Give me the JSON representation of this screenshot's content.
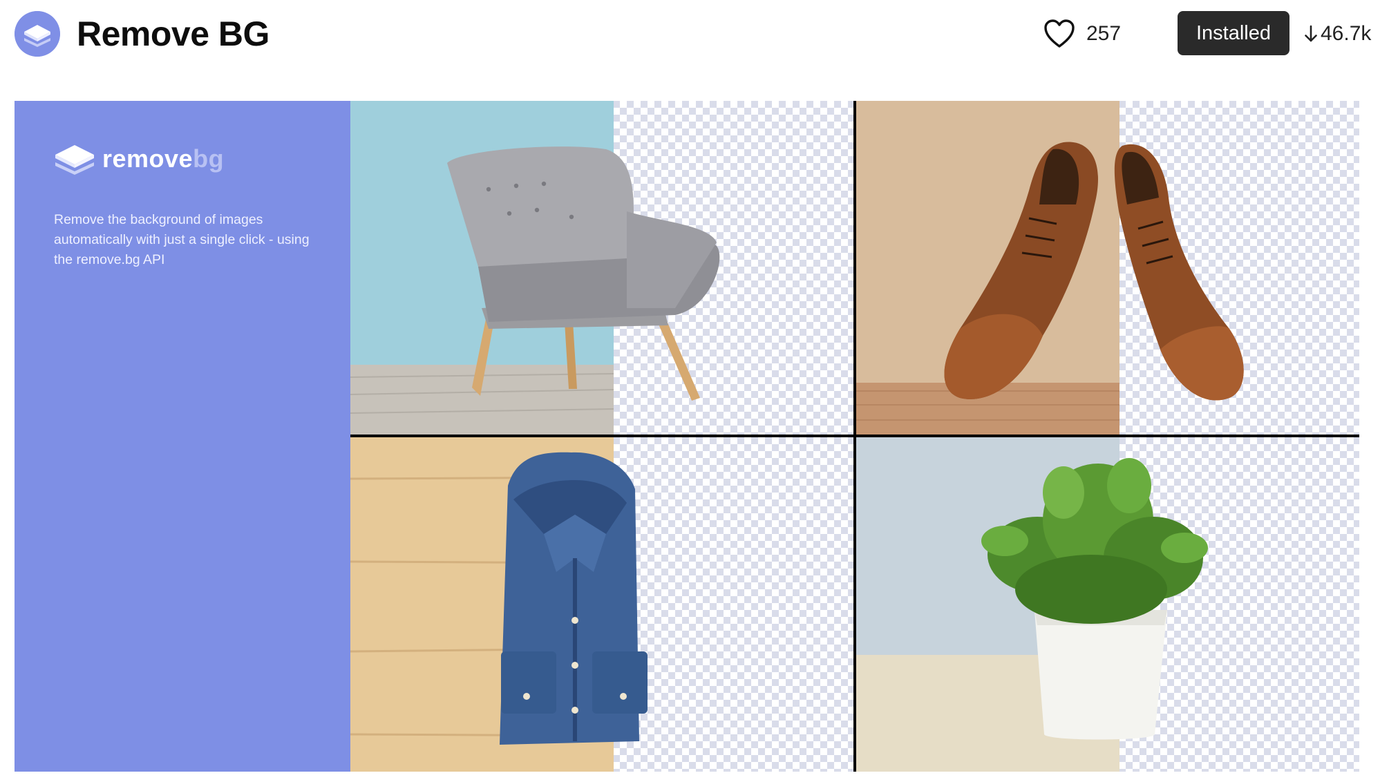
{
  "header": {
    "icon": "remove-bg-layers-icon",
    "title": "Remove BG",
    "likes": {
      "icon": "heart-icon",
      "count": "257"
    },
    "install_button": {
      "label": "Installed"
    },
    "downloads": {
      "icon": "down-arrow-icon",
      "count": "46.7k"
    }
  },
  "banner": {
    "brand": {
      "logo_icon": "layers-icon",
      "wordmark_part1": "remove",
      "wordmark_part2": "bg",
      "tagline": "Remove the background of images automatically with just a single click - using the remove.bg API"
    },
    "panel_color": "#7e8fe5",
    "images": [
      {
        "subject": "grey armchair"
      },
      {
        "subject": "brown leather shoes"
      },
      {
        "subject": "denim shirt"
      },
      {
        "subject": "potted plant"
      }
    ]
  },
  "colors": {
    "accent": "#7e8fe5",
    "button_bg": "#2a2a2a",
    "checker_light": "#ffffff",
    "checker_dark": "#d9dcea"
  }
}
